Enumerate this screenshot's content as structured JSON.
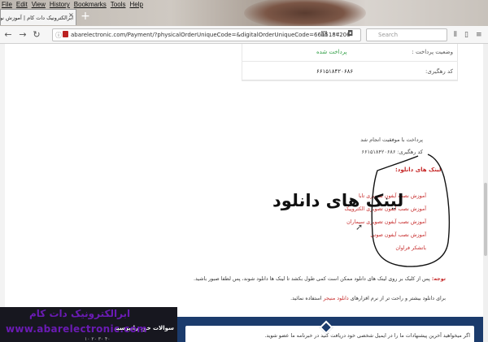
{
  "browser": {
    "menu": [
      "File",
      "Edit",
      "View",
      "History",
      "Bookmarks",
      "Tools",
      "Help"
    ],
    "tab_title": "ابرالکترونیک دات کام | آموزش نورپردازی",
    "new_tab_label": "+",
    "url": "abarelectronic.com/Payment/?physicalOrderUniqueCode=&digitalOrderUniqueCode=6615184206",
    "search_placeholder": "Search"
  },
  "order": {
    "status_label": "وضعیت پرداخت :",
    "status_value": "پرداخت شده",
    "tracking_label": "کد رهگیری:",
    "tracking_value": "۶۶۱۵۱۸۴۲۰۶۸۶"
  },
  "payment": {
    "success_text": "پرداخت با موفقیت انجام شد",
    "tracking_text": "کد رهگیری: ۶۶۱۵۱۸۴۲۰۶۸۶"
  },
  "downloads": {
    "title": "لینک های دانلود:",
    "links": [
      "آموزش نصب آیفون تصویری تابا",
      "آموزش نصب آیفون تصویری الکتروپیک",
      "آموزش نصب آیفون تصویری سیماران",
      "آموزش نصب آیفون صوتی",
      "باتشکر فراوان"
    ]
  },
  "annotation_title": "لینک های دانلود",
  "notes": {
    "note_label": "توجه:",
    "note_text": "پس از کلیک بر روی لینک های دانلود ممکن است کمی طول بکشد تا لینک ها دانلود شوند، پس لطفا صبور باشید.",
    "download_text_before": "برای دانلود بیشتر و راحت تر از نرم افزارهای",
    "download_highlight": "دانلود منیجر",
    "download_text_after": "استفاده نمائید."
  },
  "footer": {
    "faq_title": "سوالات خود رابپرسید",
    "faq_sub": "۱۰ ۲۰ ۳۰ ۴۰",
    "suggest_text": "اگر میخواهید آخرین پیشنهادات ما را در ایمیل شخصی خود دریافت کنید در خبرنامه ما عضو شوید."
  },
  "watermark": {
    "brand": "ابرالکترونیک دات کام",
    "site": "www.abarelectronic.com"
  }
}
